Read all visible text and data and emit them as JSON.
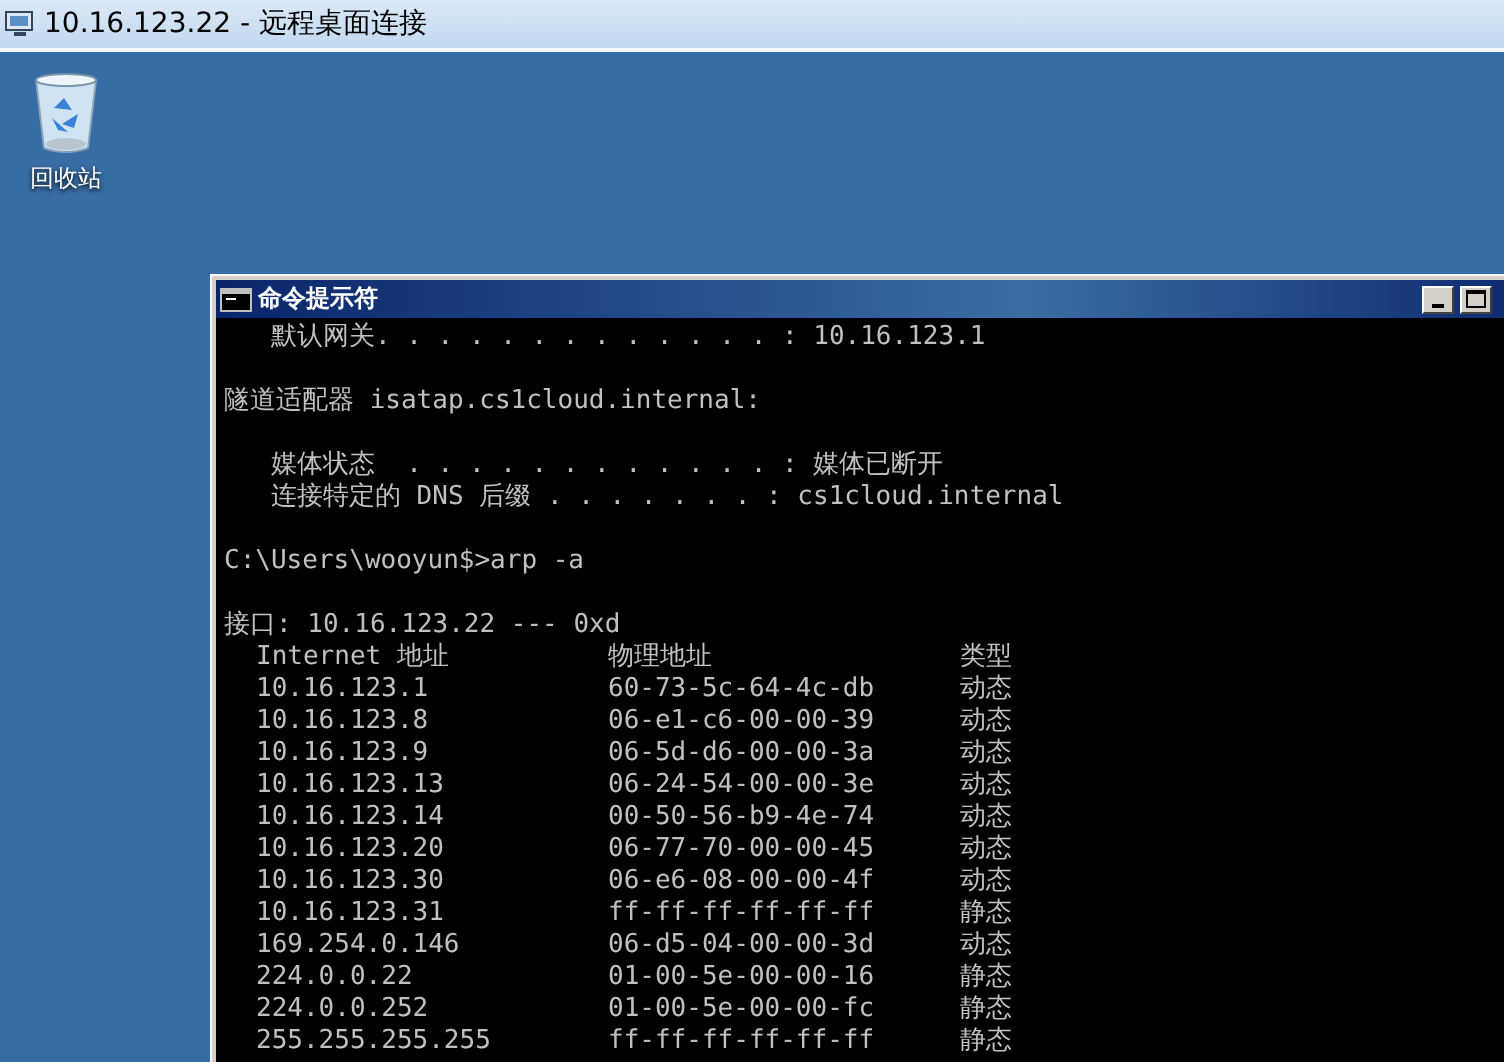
{
  "window": {
    "title": "10.16.123.22 - 远程桌面连接"
  },
  "desktop_icons": [
    {
      "label": "回收站"
    }
  ],
  "console": {
    "title": "命令提示符",
    "lines": [
      {
        "kind": "text",
        "text": "   默认网关. . . . . . . . . . . . . : 10.16.123.1"
      },
      {
        "kind": "blank"
      },
      {
        "kind": "text",
        "text": "隧道适配器 isatap.cs1cloud.internal:"
      },
      {
        "kind": "blank"
      },
      {
        "kind": "text",
        "text": "   媒体状态  . . . . . . . . . . . . : 媒体已断开"
      },
      {
        "kind": "text",
        "text": "   连接特定的 DNS 后缀 . . . . . . . : cs1cloud.internal"
      },
      {
        "kind": "blank"
      },
      {
        "kind": "text",
        "text": "C:\\Users\\wooyun$>arp -a"
      },
      {
        "kind": "blank"
      },
      {
        "kind": "text",
        "text": "接口: 10.16.123.22 --- 0xd"
      }
    ],
    "arp_table": {
      "columns": [
        "Internet 地址",
        "物理地址",
        "类型"
      ],
      "rows": [
        [
          "10.16.123.1",
          "60-73-5c-64-4c-db",
          "动态"
        ],
        [
          "10.16.123.8",
          "06-e1-c6-00-00-39",
          "动态"
        ],
        [
          "10.16.123.9",
          "06-5d-d6-00-00-3a",
          "动态"
        ],
        [
          "10.16.123.13",
          "06-24-54-00-00-3e",
          "动态"
        ],
        [
          "10.16.123.14",
          "00-50-56-b9-4e-74",
          "动态"
        ],
        [
          "10.16.123.20",
          "06-77-70-00-00-45",
          "动态"
        ],
        [
          "10.16.123.30",
          "06-e6-08-00-00-4f",
          "动态"
        ],
        [
          "10.16.123.31",
          "ff-ff-ff-ff-ff-ff",
          "静态"
        ],
        [
          "169.254.0.146",
          "06-d5-04-00-00-3d",
          "动态"
        ],
        [
          "224.0.0.22",
          "01-00-5e-00-00-16",
          "静态"
        ],
        [
          "224.0.0.252",
          "01-00-5e-00-00-fc",
          "静态"
        ],
        [
          "255.255.255.255",
          "ff-ff-ff-ff-ff-ff",
          "静态"
        ]
      ]
    }
  }
}
